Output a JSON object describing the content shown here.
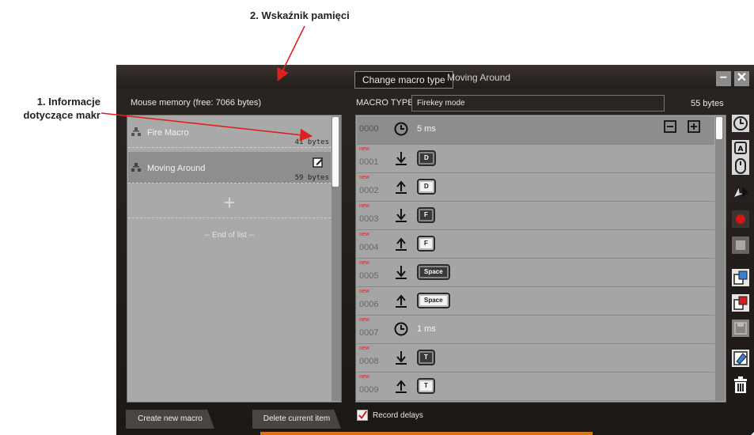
{
  "annotations": {
    "memory_indicator": "2. Wskaźnik pamięci",
    "macro_info_line1": "1. Informacje",
    "macro_info_line2": "dotyczące makr"
  },
  "window": {
    "change_type_button": "Change macro type",
    "title_macro": "Moving Around",
    "minimize_glyph": "−",
    "close_glyph": "✕"
  },
  "memory": {
    "label": "Mouse memory (free: 7066 bytes)"
  },
  "macro_type": {
    "label": "MACRO TYPE",
    "value": "Firekey mode",
    "size": "55 bytes"
  },
  "macros": [
    {
      "name": "Fire Macro",
      "bytes": "41 bytes"
    },
    {
      "name": "Moving Around",
      "bytes": "59 bytes"
    }
  ],
  "list": {
    "add_glyph": "+",
    "end_text": "-- End of list --"
  },
  "steps": [
    {
      "num": "0000",
      "new": "",
      "kind": "delay",
      "delay": "5 ms"
    },
    {
      "num": "0001",
      "new": "new",
      "kind": "down",
      "key": "D"
    },
    {
      "num": "0002",
      "new": "new",
      "kind": "up",
      "key": "D"
    },
    {
      "num": "0003",
      "new": "new",
      "kind": "down",
      "key": "F"
    },
    {
      "num": "0004",
      "new": "new",
      "kind": "up",
      "key": "F"
    },
    {
      "num": "0005",
      "new": "new",
      "kind": "down",
      "key": "Space"
    },
    {
      "num": "0006",
      "new": "new",
      "kind": "up",
      "key": "Space"
    },
    {
      "num": "0007",
      "new": "new",
      "kind": "delay",
      "delay": "1 ms"
    },
    {
      "num": "0008",
      "new": "new",
      "kind": "down",
      "key": "T"
    },
    {
      "num": "0009",
      "new": "new",
      "kind": "up",
      "key": "T"
    }
  ],
  "bottom": {
    "create_button": "Create new macro",
    "delete_button": "Delete current item",
    "record_delays": "Record delays"
  },
  "colors": {
    "accent": "#d9731b",
    "record": "#d01818",
    "new_tag": "#e02020"
  }
}
